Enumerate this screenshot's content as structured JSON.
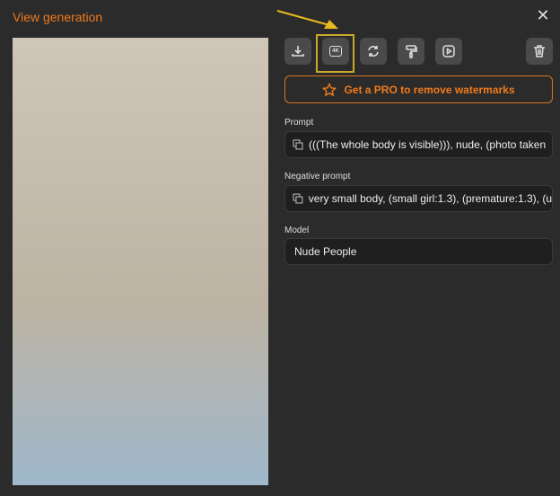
{
  "header": {
    "title": "View generation",
    "close_icon": "close-icon"
  },
  "toolbar": {
    "buttons": [
      "download-icon",
      "4k-upscale-icon",
      "regenerate-icon",
      "paint-roller-icon",
      "video-icon",
      "trash-icon"
    ],
    "upscale_label": "4K"
  },
  "pro_banner": {
    "label": "Get a PRO to remove watermarks",
    "icon": "star-icon"
  },
  "fields": {
    "prompt": {
      "label": "Prompt",
      "value": "(((The whole body is visible))), nude, (photo taken"
    },
    "negative": {
      "label": "Negative prompt",
      "value": "very small body, (small girl:1.3), (premature:1.3), (u"
    },
    "model": {
      "label": "Model",
      "value": "Nude People"
    }
  },
  "colors": {
    "accent": "#f07a1a",
    "highlight": "#c9a82a",
    "background": "#2b2b2b"
  }
}
